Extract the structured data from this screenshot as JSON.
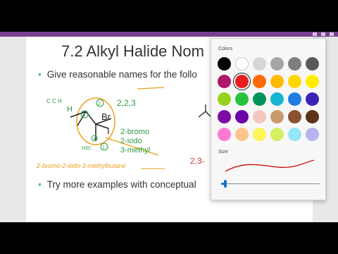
{
  "slide": {
    "title": "7.2 Alkyl Halide Nom",
    "bullets": [
      "Give reasonable names for the follo",
      "Try more examples with conceptual"
    ],
    "bullet_marker": "•"
  },
  "ink": {
    "annotation_answer": "2-bromo-2-iodo-3-methylbutane",
    "label_2_2_3": "2,2,3",
    "label_2_bromo": "2-bromo",
    "label_2_iodo": "2-iodo",
    "label_3_methyl": "3-methyl",
    "label_br": "Br",
    "label_i": "I",
    "label_h": "H",
    "label_h3c": "H3C",
    "label_sides": "C C H",
    "label_2_3": "2,3-",
    "circle_3": "3",
    "circle_2": "2",
    "circle_4": "4",
    "circle_1": "1",
    "colors": {
      "green": "#2e9a43",
      "orange": "#e9a01c",
      "blue": "#1c6fc7",
      "red": "#d23a3a",
      "black": "#222222"
    }
  },
  "picker": {
    "colors_label": "Colors",
    "size_label": "Size",
    "swatches": [
      "#000000",
      "#ffffff",
      "#d6d6d6",
      "#a5a5a5",
      "#7f7f7f",
      "#595959",
      "#b0166a",
      "#e61e1e",
      "#ff6a00",
      "#ffb900",
      "#ffd700",
      "#ffee00",
      "#96d21e",
      "#27c23c",
      "#00935a",
      "#14b4d2",
      "#1e7ee6",
      "#3c22b4",
      "#7e0da6",
      "#6b00a8",
      "#f5c6c0",
      "#c89a6e",
      "#8a5230",
      "#5e3217",
      "#ff7ad2",
      "#ffc48c",
      "#fff45a",
      "#d2f060",
      "#94e6f5",
      "#b8b4f0"
    ],
    "selected_index": 7,
    "ink_size_fraction": 0.03,
    "preview_color": "#d01818"
  }
}
